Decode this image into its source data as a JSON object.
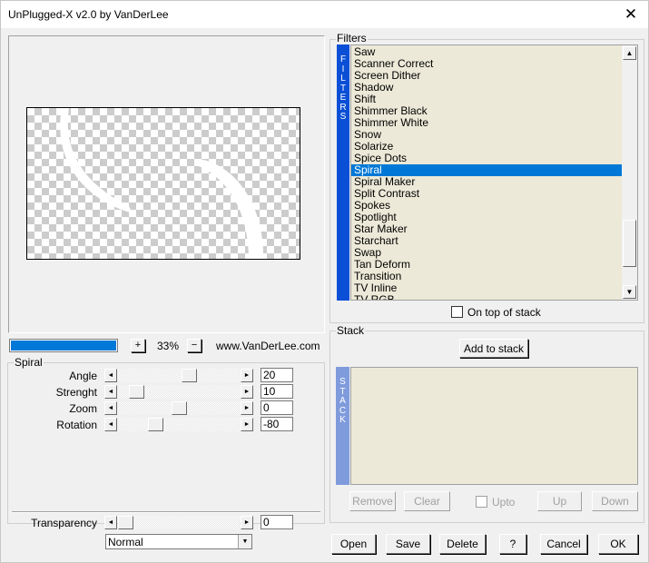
{
  "window": {
    "title": "UnPlugged-X v2.0 by VanDerLee",
    "close_glyph": "✕"
  },
  "filters": {
    "group_label": "Filters",
    "tab_text": "FILTERS",
    "items": [
      "Saw",
      "Scanner Correct",
      "Screen Dither",
      "Shadow",
      "Shift",
      "Shimmer Black",
      "Shimmer White",
      "Snow",
      "Solarize",
      "Spice Dots",
      "Spiral",
      "Spiral Maker",
      "Split Contrast",
      "Spokes",
      "Spotlight",
      "Star Maker",
      "Starchart",
      "Swap",
      "Tan Deform",
      "Transition",
      "TV Inline",
      "TV RGB"
    ],
    "selected": "Spiral",
    "on_top_label": "On top of stack",
    "scroll_up_glyph": "▲",
    "scroll_down_glyph": "▼"
  },
  "preview": {
    "progress": 1.0,
    "zoom_plus": "+",
    "zoom_minus": "−",
    "zoom_value": "33%",
    "website": "www.VanDerLee.com"
  },
  "spiral": {
    "group_label": "Spiral",
    "left_glyph": "◄",
    "right_glyph": "►",
    "params": [
      {
        "label": "Angle",
        "value": "20",
        "position": 0.6
      },
      {
        "label": "Strenght",
        "value": "10",
        "position": 0.1
      },
      {
        "label": "Zoom",
        "value": "0",
        "position": 0.5
      },
      {
        "label": "Rotation",
        "value": "-80",
        "position": 0.28
      }
    ],
    "transparency": {
      "label": "Transparency",
      "value": "0",
      "position": 0.0
    },
    "blend_mode": "Normal",
    "combo_glyph": "▼"
  },
  "stack": {
    "group_label": "Stack",
    "add_button": "Add to stack",
    "tab_text": "STACK",
    "remove": "Remove",
    "clear": "Clear",
    "upto": "Upto",
    "up": "Up",
    "down": "Down"
  },
  "footer": {
    "open": "Open",
    "save": "Save",
    "delete": "Delete",
    "help": "?",
    "cancel": "Cancel",
    "ok": "OK"
  },
  "colors": {
    "selection": "#0078d7",
    "filters_tab": "#0a4fd6",
    "stack_tab": "#7f9bdc",
    "list_background": "#ece9d8"
  }
}
